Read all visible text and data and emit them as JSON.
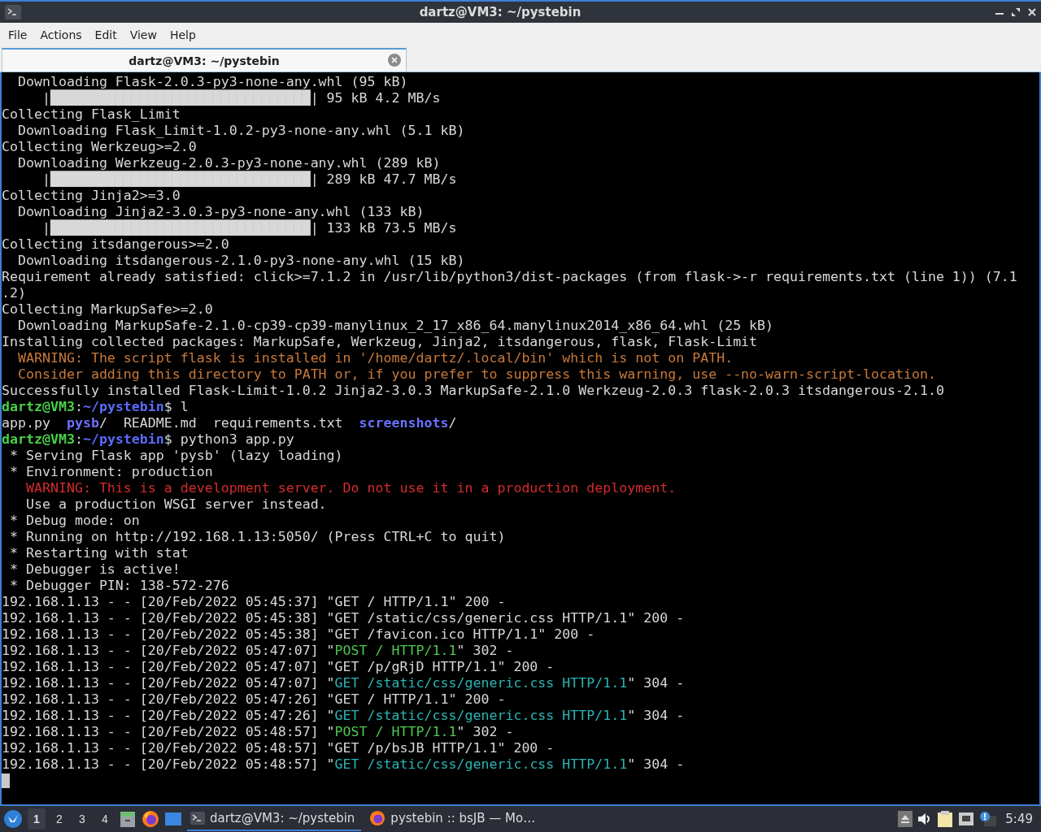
{
  "window": {
    "title": "dartz@VM3: ~/pystebin"
  },
  "menu": [
    "File",
    "Actions",
    "Edit",
    "View",
    "Help"
  ],
  "tabs": [
    {
      "label": "dartz@VM3: ~/pystebin",
      "selected": true
    }
  ],
  "terminal": {
    "lines": [
      {
        "kind": "text",
        "segments": [
          {
            "kind": "plain",
            "text": "  Downloading Flask-2.0.3-py3-none-any.whl (95 kB)"
          }
        ]
      },
      {
        "kind": "text",
        "segments": [
          {
            "kind": "plain",
            "text": "     |████████████████████████████████| 95 kB 4.2 MB/s"
          }
        ]
      },
      {
        "kind": "text",
        "segments": [
          {
            "kind": "plain",
            "text": "Collecting Flask_Limit"
          }
        ]
      },
      {
        "kind": "text",
        "segments": [
          {
            "kind": "plain",
            "text": "  Downloading Flask_Limit-1.0.2-py3-none-any.whl (5.1 kB)"
          }
        ]
      },
      {
        "kind": "text",
        "segments": [
          {
            "kind": "plain",
            "text": "Collecting Werkzeug>=2.0"
          }
        ]
      },
      {
        "kind": "text",
        "segments": [
          {
            "kind": "plain",
            "text": "  Downloading Werkzeug-2.0.3-py3-none-any.whl (289 kB)"
          }
        ]
      },
      {
        "kind": "text",
        "segments": [
          {
            "kind": "plain",
            "text": "     |████████████████████████████████| 289 kB 47.7 MB/s"
          }
        ]
      },
      {
        "kind": "text",
        "segments": [
          {
            "kind": "plain",
            "text": "Collecting Jinja2>=3.0"
          }
        ]
      },
      {
        "kind": "text",
        "segments": [
          {
            "kind": "plain",
            "text": "  Downloading Jinja2-3.0.3-py3-none-any.whl (133 kB)"
          }
        ]
      },
      {
        "kind": "text",
        "segments": [
          {
            "kind": "plain",
            "text": "     |████████████████████████████████| 133 kB 73.5 MB/s"
          }
        ]
      },
      {
        "kind": "text",
        "segments": [
          {
            "kind": "plain",
            "text": "Collecting itsdangerous>=2.0"
          }
        ]
      },
      {
        "kind": "text",
        "segments": [
          {
            "kind": "plain",
            "text": "  Downloading itsdangerous-2.1.0-py3-none-any.whl (15 kB)"
          }
        ]
      },
      {
        "kind": "text",
        "segments": [
          {
            "kind": "plain",
            "text": "Requirement already satisfied: click>=7.1.2 in /usr/lib/python3/dist-packages (from flask->-r requirements.txt (line 1)) (7.1"
          }
        ]
      },
      {
        "kind": "text",
        "segments": [
          {
            "kind": "plain",
            "text": ".2)"
          }
        ]
      },
      {
        "kind": "text",
        "segments": [
          {
            "kind": "plain",
            "text": "Collecting MarkupSafe>=2.0"
          }
        ]
      },
      {
        "kind": "text",
        "segments": [
          {
            "kind": "plain",
            "text": "  Downloading MarkupSafe-2.1.0-cp39-cp39-manylinux_2_17_x86_64.manylinux2014_x86_64.whl (25 kB)"
          }
        ]
      },
      {
        "kind": "text",
        "segments": [
          {
            "kind": "plain",
            "text": "Installing collected packages: MarkupSafe, Werkzeug, Jinja2, itsdangerous, flask, Flask-Limit"
          }
        ]
      },
      {
        "kind": "text",
        "segments": [
          {
            "kind": "warning",
            "text": "  WARNING: The script flask is installed in '/home/dartz/.local/bin' which is not on PATH."
          }
        ]
      },
      {
        "kind": "text",
        "segments": [
          {
            "kind": "warning",
            "text": "  Consider adding this directory to PATH or, if you prefer to suppress this warning, use --no-warn-script-location."
          }
        ]
      },
      {
        "kind": "text",
        "segments": [
          {
            "kind": "plain",
            "text": "Successfully installed Flask-Limit-1.0.2 Jinja2-3.0.3 MarkupSafe-2.1.0 Werkzeug-2.0.3 flask-2.0.3 itsdangerous-2.1.0"
          }
        ]
      },
      {
        "kind": "text",
        "segments": [
          {
            "kind": "user",
            "text": "dartz@VM3"
          },
          {
            "kind": "plain",
            "text": ":"
          },
          {
            "kind": "path",
            "text": "~/pystebin"
          },
          {
            "kind": "plain",
            "text": "$ l"
          }
        ]
      },
      {
        "kind": "text",
        "segments": [
          {
            "kind": "plain",
            "text": "app.py  "
          },
          {
            "kind": "dir",
            "text": "pysb"
          },
          {
            "kind": "plain",
            "text": "/  README.md  requirements.txt  "
          },
          {
            "kind": "dir",
            "text": "screenshots"
          },
          {
            "kind": "plain",
            "text": "/"
          }
        ]
      },
      {
        "kind": "text",
        "segments": [
          {
            "kind": "user",
            "text": "dartz@VM3"
          },
          {
            "kind": "plain",
            "text": ":"
          },
          {
            "kind": "path",
            "text": "~/pystebin"
          },
          {
            "kind": "plain",
            "text": "$ python3 app.py"
          }
        ]
      },
      {
        "kind": "text",
        "segments": [
          {
            "kind": "plain",
            "text": " * Serving Flask app 'pysb' (lazy loading)"
          }
        ]
      },
      {
        "kind": "text",
        "segments": [
          {
            "kind": "plain",
            "text": " * Environment: production"
          }
        ]
      },
      {
        "kind": "text",
        "segments": [
          {
            "kind": "error",
            "text": "   WARNING: This is a development server. Do not use it in a production deployment."
          }
        ]
      },
      {
        "kind": "text",
        "segments": [
          {
            "kind": "plain",
            "text": "   Use a production WSGI server instead."
          }
        ]
      },
      {
        "kind": "text",
        "segments": [
          {
            "kind": "plain",
            "text": " * Debug mode: on"
          }
        ]
      },
      {
        "kind": "text",
        "segments": [
          {
            "kind": "plain",
            "text": " * Running on http://192.168.1.13:5050/ (Press CTRL+C to quit)"
          }
        ]
      },
      {
        "kind": "text",
        "segments": [
          {
            "kind": "plain",
            "text": " * Restarting with stat"
          }
        ]
      },
      {
        "kind": "text",
        "segments": [
          {
            "kind": "plain",
            "text": " * Debugger is active!"
          }
        ]
      },
      {
        "kind": "text",
        "segments": [
          {
            "kind": "plain",
            "text": " * Debugger PIN: 138-572-276"
          }
        ]
      },
      {
        "kind": "text",
        "segments": [
          {
            "kind": "plain",
            "text": "192.168.1.13 - - [20/Feb/2022 05:45:37] \"GET / HTTP/1.1\" 200 -"
          }
        ]
      },
      {
        "kind": "text",
        "segments": [
          {
            "kind": "plain",
            "text": "192.168.1.13 - - [20/Feb/2022 05:45:38] \"GET /static/css/generic.css HTTP/1.1\" 200 -"
          }
        ]
      },
      {
        "kind": "text",
        "segments": [
          {
            "kind": "plain",
            "text": "192.168.1.13 - - [20/Feb/2022 05:45:38] \"GET /favicon.ico HTTP/1.1\" 200 -"
          }
        ]
      },
      {
        "kind": "text",
        "segments": [
          {
            "kind": "plain",
            "text": "192.168.1.13 - - [20/Feb/2022 05:47:07] \""
          },
          {
            "kind": "green",
            "text": "POST / HTTP/1.1"
          },
          {
            "kind": "plain",
            "text": "\" 302 -"
          }
        ]
      },
      {
        "kind": "text",
        "segments": [
          {
            "kind": "plain",
            "text": "192.168.1.13 - - [20/Feb/2022 05:47:07] \"GET /p/gRjD HTTP/1.1\" 200 -"
          }
        ]
      },
      {
        "kind": "text",
        "segments": [
          {
            "kind": "plain",
            "text": "192.168.1.13 - - [20/Feb/2022 05:47:07] \""
          },
          {
            "kind": "cyan",
            "text": "GET /static/css/generic.css HTTP/1.1"
          },
          {
            "kind": "plain",
            "text": "\" 304 -"
          }
        ]
      },
      {
        "kind": "text",
        "segments": [
          {
            "kind": "plain",
            "text": "192.168.1.13 - - [20/Feb/2022 05:47:26] \"GET / HTTP/1.1\" 200 -"
          }
        ]
      },
      {
        "kind": "text",
        "segments": [
          {
            "kind": "plain",
            "text": "192.168.1.13 - - [20/Feb/2022 05:47:26] \""
          },
          {
            "kind": "cyan",
            "text": "GET /static/css/generic.css HTTP/1.1"
          },
          {
            "kind": "plain",
            "text": "\" 304 -"
          }
        ]
      },
      {
        "kind": "text",
        "segments": [
          {
            "kind": "plain",
            "text": "192.168.1.13 - - [20/Feb/2022 05:48:57] \""
          },
          {
            "kind": "green",
            "text": "POST / HTTP/1.1"
          },
          {
            "kind": "plain",
            "text": "\" 302 -"
          }
        ]
      },
      {
        "kind": "text",
        "segments": [
          {
            "kind": "plain",
            "text": "192.168.1.13 - - [20/Feb/2022 05:48:57] \"GET /p/bsJB HTTP/1.1\" 200 -"
          }
        ]
      },
      {
        "kind": "text",
        "segments": [
          {
            "kind": "plain",
            "text": "192.168.1.13 - - [20/Feb/2022 05:48:57] \""
          },
          {
            "kind": "cyan",
            "text": "GET /static/css/generic.css HTTP/1.1"
          },
          {
            "kind": "plain",
            "text": "\" 304 -"
          }
        ]
      },
      {
        "kind": "cursor"
      }
    ]
  },
  "taskbar": {
    "workspaces": [
      {
        "label": "1",
        "selected": true
      },
      {
        "label": "2",
        "selected": false
      },
      {
        "label": "3",
        "selected": false
      },
      {
        "label": "4",
        "selected": false
      }
    ],
    "tasks": [
      {
        "kind": "terminal",
        "label": "dartz@VM3: ~/pystebin",
        "selected": true
      },
      {
        "kind": "browser",
        "label": "pystebin :: bsJB — Mo…",
        "selected": false
      }
    ],
    "clock": "5:49"
  }
}
